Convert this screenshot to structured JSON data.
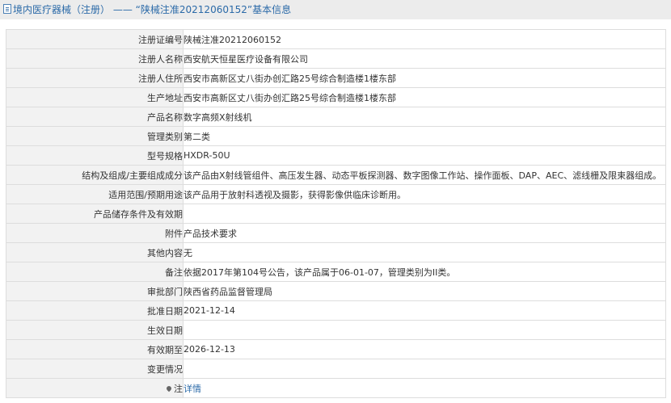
{
  "header": {
    "icon": "document-icon",
    "prefix": "境内医疗器械（注册）",
    "separator": "——",
    "title": "“陕械注准20212060152”基本信息"
  },
  "rows": [
    {
      "label": "注册证编号",
      "value": "陕械注准20212060152"
    },
    {
      "label": "注册人名称",
      "value": "西安航天恒星医疗设备有限公司"
    },
    {
      "label": "注册人住所",
      "value": "西安市高新区丈八街办创汇路25号综合制造楼1楼东部"
    },
    {
      "label": "生产地址",
      "value": "西安市高新区丈八街办创汇路25号综合制造楼1楼东部"
    },
    {
      "label": "产品名称",
      "value": "数字高频X射线机"
    },
    {
      "label": "管理类别",
      "value": "第二类"
    },
    {
      "label": "型号规格",
      "value": "HXDR-50U"
    },
    {
      "label": "结构及组成/主要组成成分",
      "value": "该产品由X射线管组件、高压发生器、动态平板探测器、数字图像工作站、操作面板、DAP、AEC、滤线栅及限束器组成。"
    },
    {
      "label": "适用范围/预期用途",
      "value": "该产品用于放射科透视及摄影，获得影像供临床诊断用。"
    },
    {
      "label": "产品储存条件及有效期",
      "value": ""
    },
    {
      "label": "附件",
      "value": "产品技术要求"
    },
    {
      "label": "其他内容",
      "value": "无"
    },
    {
      "label": "备注",
      "value": "依据2017年第104号公告，该产品属于06-01-07，管理类别为II类。"
    },
    {
      "label": "审批部门",
      "value": "陕西省药品监督管理局"
    },
    {
      "label": "批准日期",
      "value": "2021-12-14"
    },
    {
      "label": "生效日期",
      "value": ""
    },
    {
      "label": "有效期至",
      "value": "2026-12-13"
    },
    {
      "label": "变更情况",
      "value": ""
    }
  ],
  "note_row": {
    "icon": "pin-icon",
    "label": "注",
    "link_text": "详情"
  },
  "colors": {
    "header_bg": "#ececec",
    "header_text": "#2b6aa8",
    "label_bg": "#f2f2f2",
    "border": "#dddddd",
    "link": "#2b6aa8"
  }
}
